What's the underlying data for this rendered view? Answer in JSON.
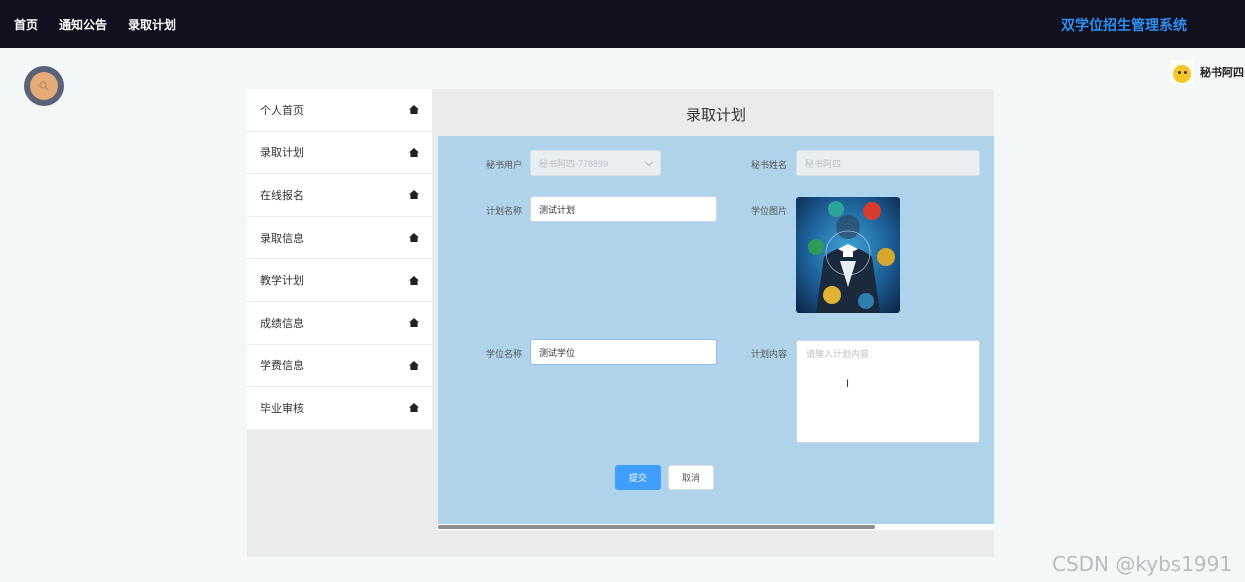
{
  "topnav": {
    "items": [
      "首页",
      "通知公告",
      "录取计划"
    ]
  },
  "system_title": "双学位招生管理系统",
  "user": {
    "name": "秘书阿四"
  },
  "sidebar": {
    "items": [
      {
        "label": "个人首页",
        "icon": "home-icon"
      },
      {
        "label": "录取计划",
        "icon": "home-icon"
      },
      {
        "label": "在线报名",
        "icon": "home-icon"
      },
      {
        "label": "录取信息",
        "icon": "home-icon"
      },
      {
        "label": "教学计划",
        "icon": "home-icon"
      },
      {
        "label": "成绩信息",
        "icon": "home-icon"
      },
      {
        "label": "学费信息",
        "icon": "home-icon"
      },
      {
        "label": "毕业审核",
        "icon": "home-icon"
      }
    ]
  },
  "page_title": "录取计划",
  "form": {
    "secretary_user": {
      "label": "秘书用户",
      "value": "秘书阿四-778899"
    },
    "secretary_name": {
      "label": "秘书姓名",
      "placeholder": "秘书阿四"
    },
    "plan_name": {
      "label": "计划名称",
      "value": "测试计划"
    },
    "degree_image": {
      "label": "学位图片"
    },
    "degree_name": {
      "label": "学位名称",
      "value": "测试学位"
    },
    "plan_content": {
      "label": "计划内容",
      "placeholder": "请输入计划内容"
    },
    "submit_label": "提交",
    "cancel_label": "取消"
  },
  "watermark": "CSDN @kybs1991",
  "colors": {
    "topbar": "#10101f",
    "title_accent": "#2e8ff0",
    "form_bg": "#afd3ea",
    "primary": "#409eff"
  }
}
